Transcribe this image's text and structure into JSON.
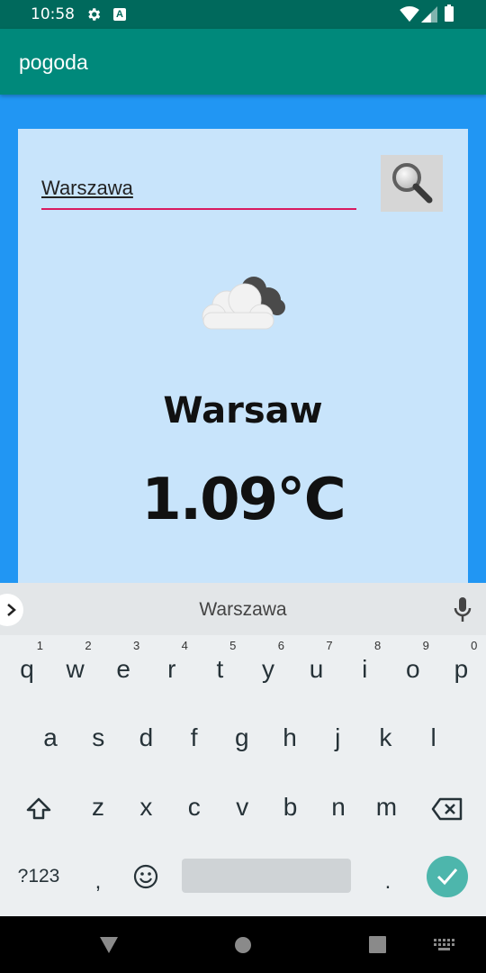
{
  "status_bar": {
    "time": "10:58",
    "icons": [
      "gear-icon",
      "a-icon",
      "wifi-icon",
      "signal-icon",
      "battery-icon"
    ]
  },
  "app_bar": {
    "title": "pogoda"
  },
  "search": {
    "value": "Warszawa",
    "button_icon": "magnifier-icon"
  },
  "weather": {
    "icon": "cloud-icon",
    "city": "Warsaw",
    "temperature": "1.09℃"
  },
  "keyboard": {
    "suggestion": "Warszawa",
    "row1": [
      {
        "k": "q",
        "h": "1"
      },
      {
        "k": "w",
        "h": "2"
      },
      {
        "k": "e",
        "h": "3"
      },
      {
        "k": "r",
        "h": "4"
      },
      {
        "k": "t",
        "h": "5"
      },
      {
        "k": "y",
        "h": "6"
      },
      {
        "k": "u",
        "h": "7"
      },
      {
        "k": "i",
        "h": "8"
      },
      {
        "k": "o",
        "h": "9"
      },
      {
        "k": "p",
        "h": "0"
      }
    ],
    "row2": [
      "a",
      "s",
      "d",
      "f",
      "g",
      "h",
      "j",
      "k",
      "l"
    ],
    "row3": [
      "z",
      "x",
      "c",
      "v",
      "b",
      "n",
      "m"
    ],
    "symbols_label": "?123",
    "comma": ",",
    "period": "."
  },
  "colors": {
    "primary": "#00897b",
    "primary_dark": "#00695c",
    "background": "#2196f3",
    "card": "#c8e4fb",
    "accent": "#d81b60",
    "enter": "#4db6ac"
  }
}
